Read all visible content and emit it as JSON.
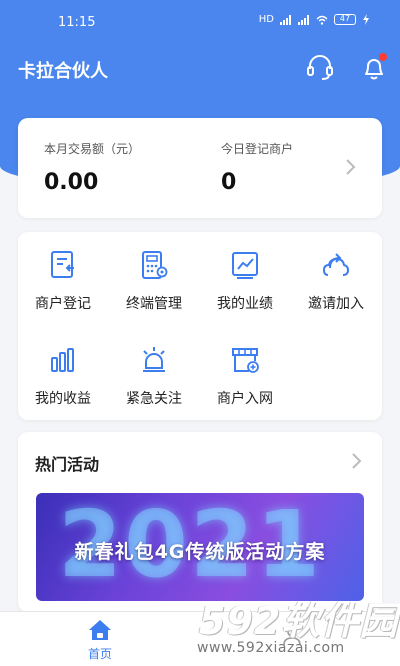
{
  "status_bar": {
    "time": "11:15",
    "network": "HD",
    "battery": "47"
  },
  "header": {
    "title": "卡拉合伙人"
  },
  "stats": [
    {
      "label": "本月交易额（元）",
      "value": "0.00"
    },
    {
      "label": "今日登记商户",
      "value": "0"
    }
  ],
  "menu": [
    {
      "label": "商户登记",
      "icon": "register-icon"
    },
    {
      "label": "终端管理",
      "icon": "terminal-icon"
    },
    {
      "label": "我的业绩",
      "icon": "performance-icon"
    },
    {
      "label": "邀请加入",
      "icon": "invite-icon"
    },
    {
      "label": "我的收益",
      "icon": "earnings-icon"
    },
    {
      "label": "紧急关注",
      "icon": "alarm-icon"
    },
    {
      "label": "商户入网",
      "icon": "store-icon"
    }
  ],
  "activity": {
    "title": "热门活动",
    "banner_year": "2021",
    "banner_text": "新春礼包4G传统版活动方案"
  },
  "tabbar": {
    "home_label": "首页"
  },
  "watermark": {
    "logo": "592软件园",
    "url": "www.592xiazai.com"
  },
  "colors": {
    "primary": "#4a86ee",
    "accent_red": "#ff3b30",
    "icon_blue": "#3c7ef0"
  }
}
